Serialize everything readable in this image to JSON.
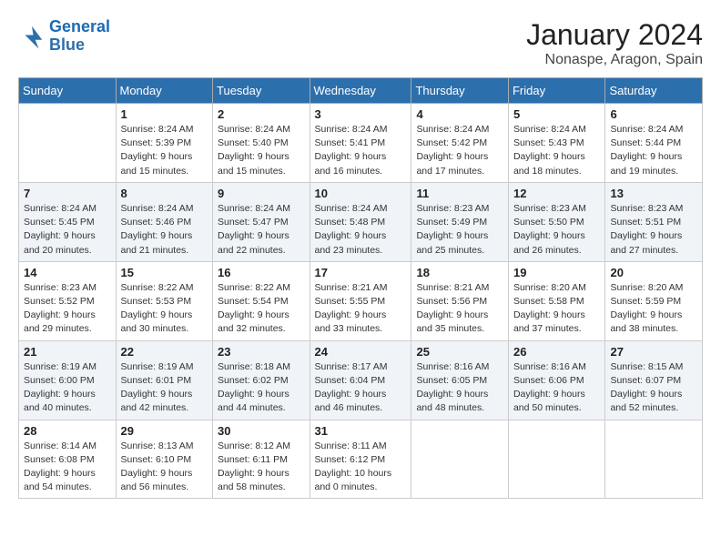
{
  "header": {
    "logo_line1": "General",
    "logo_line2": "Blue",
    "title": "January 2024",
    "subtitle": "Nonaspe, Aragon, Spain"
  },
  "days_of_week": [
    "Sunday",
    "Monday",
    "Tuesday",
    "Wednesday",
    "Thursday",
    "Friday",
    "Saturday"
  ],
  "weeks": [
    [
      {
        "day": "",
        "detail": ""
      },
      {
        "day": "1",
        "detail": "Sunrise: 8:24 AM\nSunset: 5:39 PM\nDaylight: 9 hours\nand 15 minutes."
      },
      {
        "day": "2",
        "detail": "Sunrise: 8:24 AM\nSunset: 5:40 PM\nDaylight: 9 hours\nand 15 minutes."
      },
      {
        "day": "3",
        "detail": "Sunrise: 8:24 AM\nSunset: 5:41 PM\nDaylight: 9 hours\nand 16 minutes."
      },
      {
        "day": "4",
        "detail": "Sunrise: 8:24 AM\nSunset: 5:42 PM\nDaylight: 9 hours\nand 17 minutes."
      },
      {
        "day": "5",
        "detail": "Sunrise: 8:24 AM\nSunset: 5:43 PM\nDaylight: 9 hours\nand 18 minutes."
      },
      {
        "day": "6",
        "detail": "Sunrise: 8:24 AM\nSunset: 5:44 PM\nDaylight: 9 hours\nand 19 minutes."
      }
    ],
    [
      {
        "day": "7",
        "detail": "Sunrise: 8:24 AM\nSunset: 5:45 PM\nDaylight: 9 hours\nand 20 minutes."
      },
      {
        "day": "8",
        "detail": "Sunrise: 8:24 AM\nSunset: 5:46 PM\nDaylight: 9 hours\nand 21 minutes."
      },
      {
        "day": "9",
        "detail": "Sunrise: 8:24 AM\nSunset: 5:47 PM\nDaylight: 9 hours\nand 22 minutes."
      },
      {
        "day": "10",
        "detail": "Sunrise: 8:24 AM\nSunset: 5:48 PM\nDaylight: 9 hours\nand 23 minutes."
      },
      {
        "day": "11",
        "detail": "Sunrise: 8:23 AM\nSunset: 5:49 PM\nDaylight: 9 hours\nand 25 minutes."
      },
      {
        "day": "12",
        "detail": "Sunrise: 8:23 AM\nSunset: 5:50 PM\nDaylight: 9 hours\nand 26 minutes."
      },
      {
        "day": "13",
        "detail": "Sunrise: 8:23 AM\nSunset: 5:51 PM\nDaylight: 9 hours\nand 27 minutes."
      }
    ],
    [
      {
        "day": "14",
        "detail": "Sunrise: 8:23 AM\nSunset: 5:52 PM\nDaylight: 9 hours\nand 29 minutes."
      },
      {
        "day": "15",
        "detail": "Sunrise: 8:22 AM\nSunset: 5:53 PM\nDaylight: 9 hours\nand 30 minutes."
      },
      {
        "day": "16",
        "detail": "Sunrise: 8:22 AM\nSunset: 5:54 PM\nDaylight: 9 hours\nand 32 minutes."
      },
      {
        "day": "17",
        "detail": "Sunrise: 8:21 AM\nSunset: 5:55 PM\nDaylight: 9 hours\nand 33 minutes."
      },
      {
        "day": "18",
        "detail": "Sunrise: 8:21 AM\nSunset: 5:56 PM\nDaylight: 9 hours\nand 35 minutes."
      },
      {
        "day": "19",
        "detail": "Sunrise: 8:20 AM\nSunset: 5:58 PM\nDaylight: 9 hours\nand 37 minutes."
      },
      {
        "day": "20",
        "detail": "Sunrise: 8:20 AM\nSunset: 5:59 PM\nDaylight: 9 hours\nand 38 minutes."
      }
    ],
    [
      {
        "day": "21",
        "detail": "Sunrise: 8:19 AM\nSunset: 6:00 PM\nDaylight: 9 hours\nand 40 minutes."
      },
      {
        "day": "22",
        "detail": "Sunrise: 8:19 AM\nSunset: 6:01 PM\nDaylight: 9 hours\nand 42 minutes."
      },
      {
        "day": "23",
        "detail": "Sunrise: 8:18 AM\nSunset: 6:02 PM\nDaylight: 9 hours\nand 44 minutes."
      },
      {
        "day": "24",
        "detail": "Sunrise: 8:17 AM\nSunset: 6:04 PM\nDaylight: 9 hours\nand 46 minutes."
      },
      {
        "day": "25",
        "detail": "Sunrise: 8:16 AM\nSunset: 6:05 PM\nDaylight: 9 hours\nand 48 minutes."
      },
      {
        "day": "26",
        "detail": "Sunrise: 8:16 AM\nSunset: 6:06 PM\nDaylight: 9 hours\nand 50 minutes."
      },
      {
        "day": "27",
        "detail": "Sunrise: 8:15 AM\nSunset: 6:07 PM\nDaylight: 9 hours\nand 52 minutes."
      }
    ],
    [
      {
        "day": "28",
        "detail": "Sunrise: 8:14 AM\nSunset: 6:08 PM\nDaylight: 9 hours\nand 54 minutes."
      },
      {
        "day": "29",
        "detail": "Sunrise: 8:13 AM\nSunset: 6:10 PM\nDaylight: 9 hours\nand 56 minutes."
      },
      {
        "day": "30",
        "detail": "Sunrise: 8:12 AM\nSunset: 6:11 PM\nDaylight: 9 hours\nand 58 minutes."
      },
      {
        "day": "31",
        "detail": "Sunrise: 8:11 AM\nSunset: 6:12 PM\nDaylight: 10 hours\nand 0 minutes."
      },
      {
        "day": "",
        "detail": ""
      },
      {
        "day": "",
        "detail": ""
      },
      {
        "day": "",
        "detail": ""
      }
    ]
  ]
}
